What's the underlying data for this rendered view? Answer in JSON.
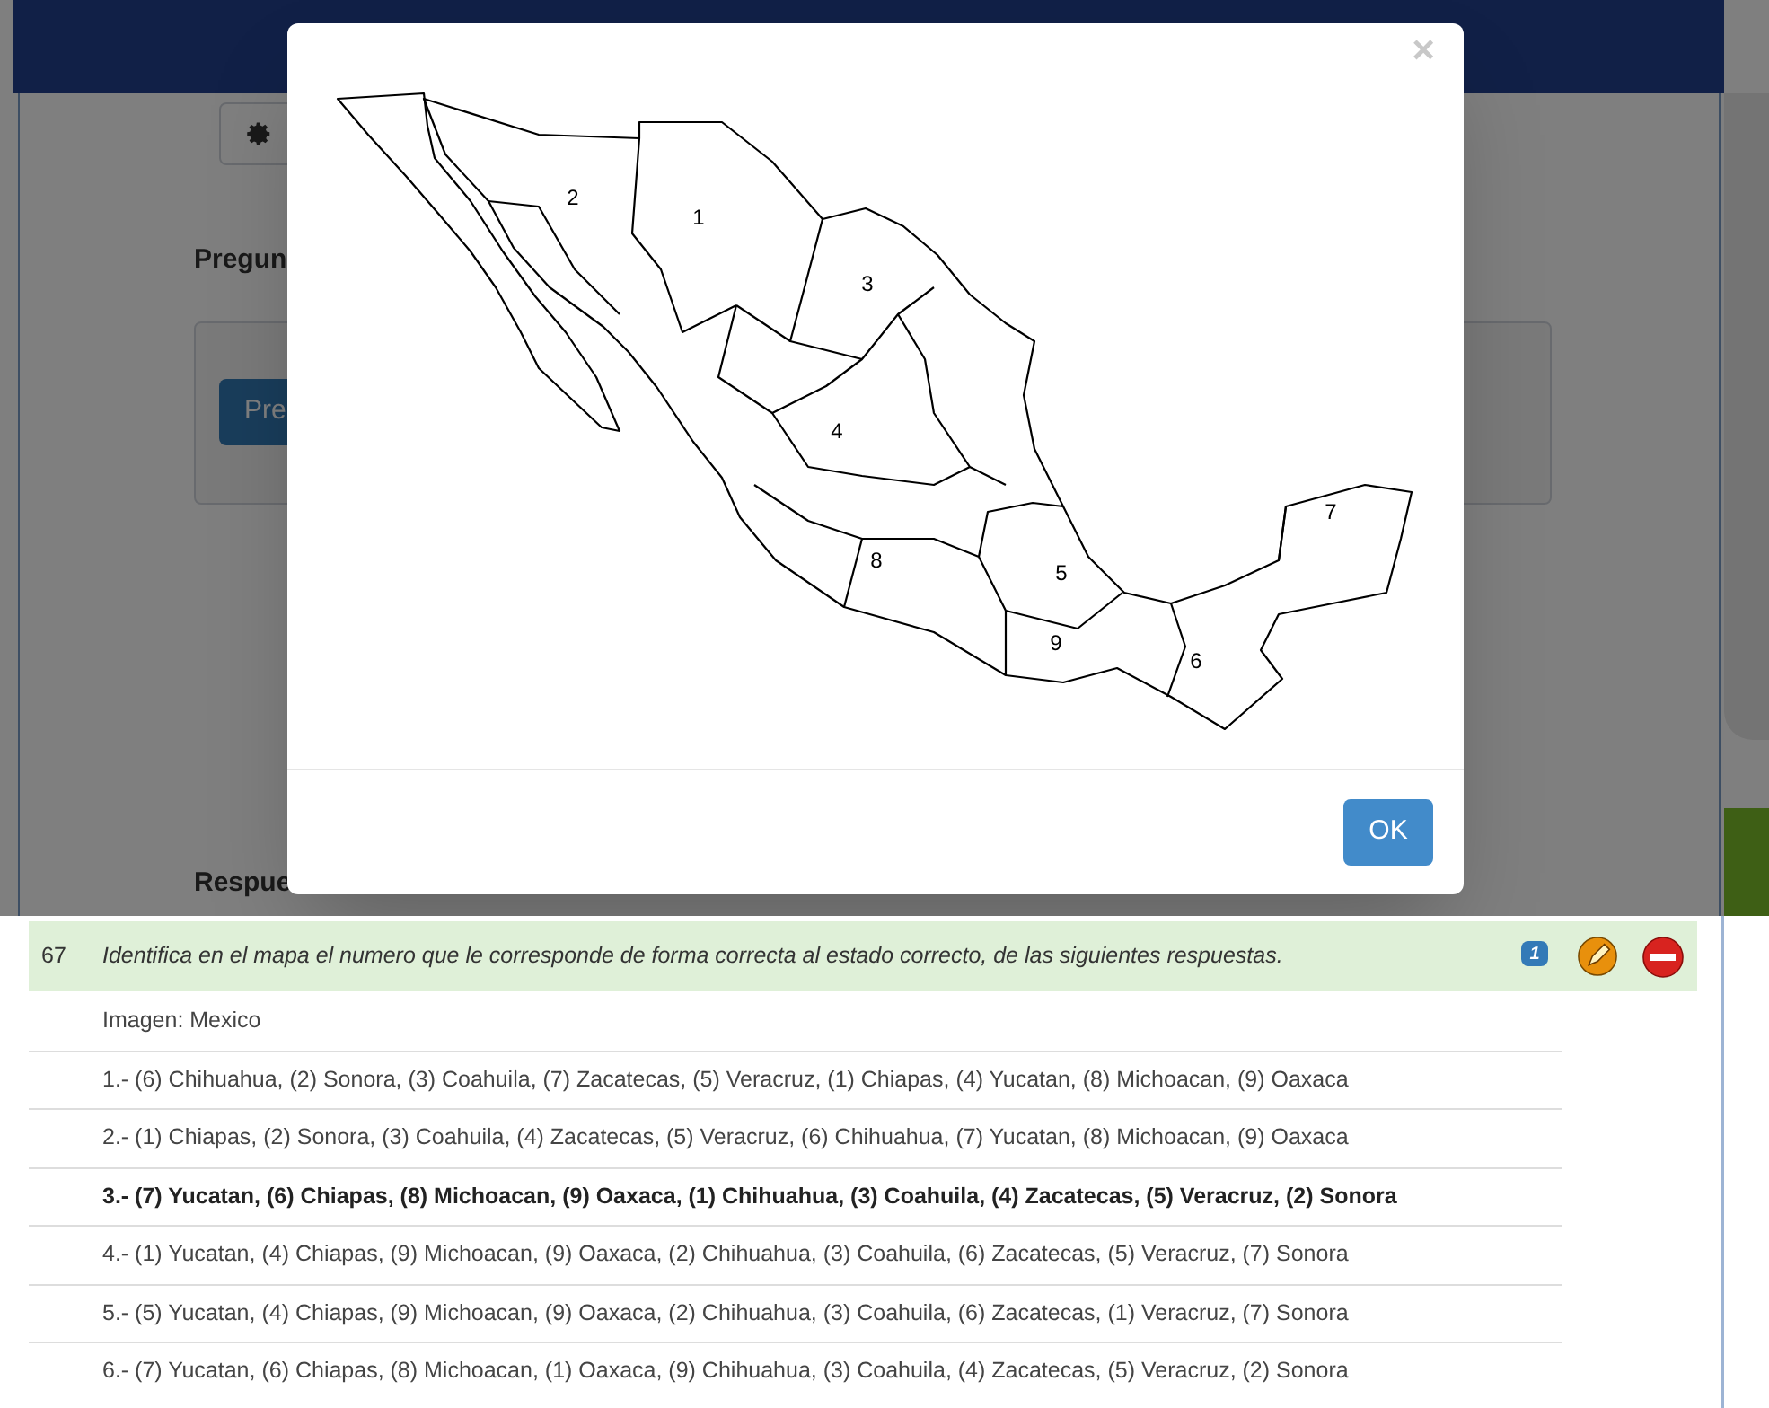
{
  "page": {
    "section_heading": "Pregun",
    "button": "Pre",
    "answers_heading": "Respue"
  },
  "modal": {
    "close": "×",
    "map_labels": [
      "1",
      "2",
      "3",
      "4",
      "5",
      "6",
      "7",
      "8",
      "9"
    ],
    "ok_button": "OK"
  },
  "question": {
    "number": "67",
    "text": "Identifica en el mapa el numero que le corresponde de forma correcta al estado correcto, de las siguientes respuestas.",
    "badge": "1",
    "image_line": "Imagen: Mexico",
    "answers": [
      {
        "text": "1.- (6) Chihuahua, (2) Sonora, (3) Coahuila, (7) Zacatecas, (5) Veracruz, (1) Chiapas, (4) Yucatan, (8) Michoacan, (9) Oaxaca",
        "correct": false
      },
      {
        "text": "2.- (1) Chiapas, (2) Sonora, (3) Coahuila, (4) Zacatecas, (5) Veracruz, (6) Chihuahua, (7) Yucatan, (8) Michoacan, (9) Oaxaca",
        "correct": false
      },
      {
        "text": "3.- (7) Yucatan, (6) Chiapas, (8) Michoacan, (9) Oaxaca, (1) Chihuahua, (3) Coahuila, (4) Zacatecas, (5) Veracruz, (2) Sonora",
        "correct": true
      },
      {
        "text": "4.- (1) Yucatan, (4) Chiapas, (9) Michoacan, (9) Oaxaca, (2) Chihuahua, (3) Coahuila, (6) Zacatecas, (5) Veracruz, (7) Sonora",
        "correct": false
      },
      {
        "text": "5.- (5) Yucatan, (4) Chiapas, (9) Michoacan, (9) Oaxaca, (2) Chihuahua, (3) Coahuila, (6) Zacatecas, (1) Veracruz, (7) Sonora",
        "correct": false
      },
      {
        "text": "6.- (7) Yucatan, (6) Chiapas, (8) Michoacan, (1) Oaxaca, (9) Chihuahua, (3) Coahuila, (4) Zacatecas, (5) Veracruz, (2) Sonora",
        "correct": false
      }
    ]
  }
}
